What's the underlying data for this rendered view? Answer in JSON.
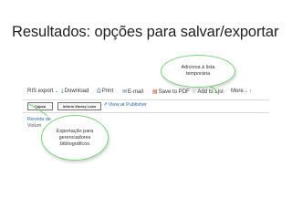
{
  "slide": {
    "title": "Resultados: opções para salvar/exportar"
  },
  "toolbar": {
    "ris_export": "RIS export",
    "download": "Download",
    "print": "Print",
    "email": "E-mail",
    "save_pdf": "Save to PDF",
    "add_list": "Add to List",
    "more": "More..."
  },
  "subrow": {
    "logo1": "Capsa",
    "logo2": "Inform library Loan",
    "view_publisher": "View at Publisher"
  },
  "journal": {
    "name": "Revista de",
    "volume": "Volum"
  },
  "callouts": {
    "top_line1": "Adiciona à lista",
    "top_line2": "temporária",
    "bottom_line1": "Exportação para",
    "bottom_line2": "gerenciadores",
    "bottom_line3": "bibliográficos"
  },
  "colors": {
    "link_blue": "#2b6cb8",
    "callout_border": "#7fd37f"
  },
  "icons": [
    "chevron-down-icon",
    "download-icon",
    "print-icon",
    "email-icon",
    "pdf-icon",
    "star-icon",
    "external-link-icon"
  ]
}
